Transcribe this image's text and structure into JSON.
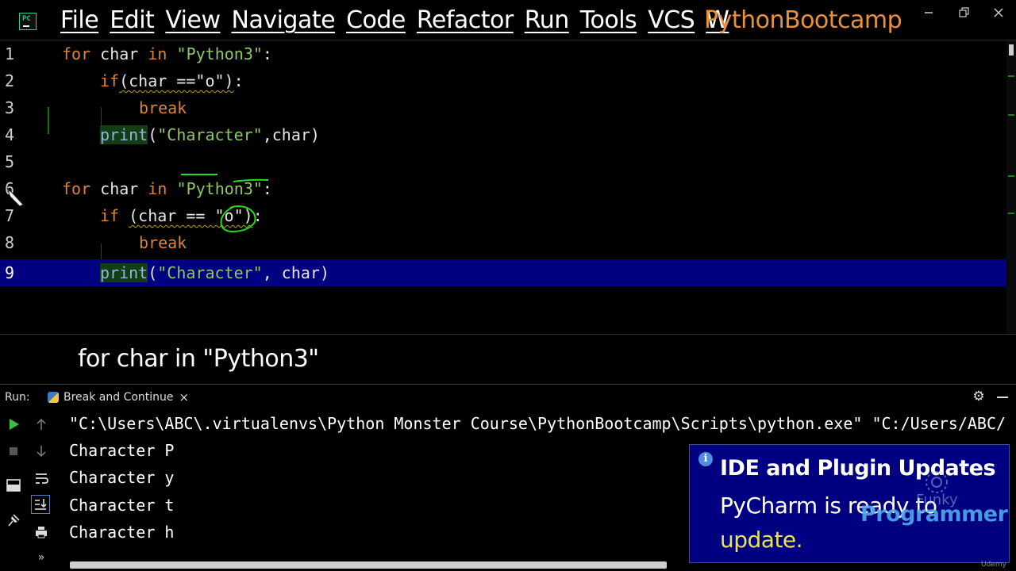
{
  "menubar": {
    "items": [
      "File",
      "Edit",
      "View",
      "Navigate",
      "Code",
      "Refactor",
      "Run",
      "Tools",
      "VCS",
      "W"
    ],
    "project": "PythonBootcamp"
  },
  "editor": {
    "line_numbers": [
      "1",
      "2",
      "3",
      "4",
      "5",
      "6",
      "7",
      "8",
      "9"
    ],
    "current_line": 9,
    "tokens": {
      "for": "for",
      "char": "char",
      "in": "in",
      "python3": "\"Python3\"",
      "colon": ":",
      "if": "if",
      "cond1": "(char ==\"o\")",
      "cond2": "(char == \"o\")",
      "break": "break",
      "print": "print",
      "open": "(",
      "character": "\"Character\"",
      "args1": ",char)",
      "args2": ", char)"
    }
  },
  "caption": "for char in \"Python3\"",
  "run_panel": {
    "label": "Run:",
    "tab_label": "Break and Continue",
    "tab_close": "×",
    "output": [
      "\"C:\\Users\\ABC\\.virtualenvs\\Python Monster Course\\PythonBootcamp\\Scripts\\python.exe\" \"C:/Users/ABC/",
      "Character P",
      "Character y",
      "Character t",
      "Character h"
    ],
    "more_glyph": "»"
  },
  "notification": {
    "title": "IDE and Plugin Updates",
    "body": "PyCharm is ready to",
    "link": "update."
  },
  "watermark": {
    "line1": "Funky",
    "line2": "Programmer",
    "udemy": "Udemy"
  },
  "colors": {
    "keyword": "#d7863b",
    "string": "#8cc864",
    "current_line": "#000080",
    "project_title": "#e8913a",
    "link": "#e7e64f"
  },
  "icons": [
    "pycharm-logo-icon",
    "run-icon",
    "stop-icon",
    "layout-icon",
    "pin-icon",
    "up-arrow-icon",
    "down-arrow-icon",
    "soft-wrap-icon",
    "scroll-to-end-icon",
    "print-icon",
    "gear-icon",
    "minimize-icon",
    "info-icon",
    "python-icon",
    "pencil-cursor-icon"
  ]
}
